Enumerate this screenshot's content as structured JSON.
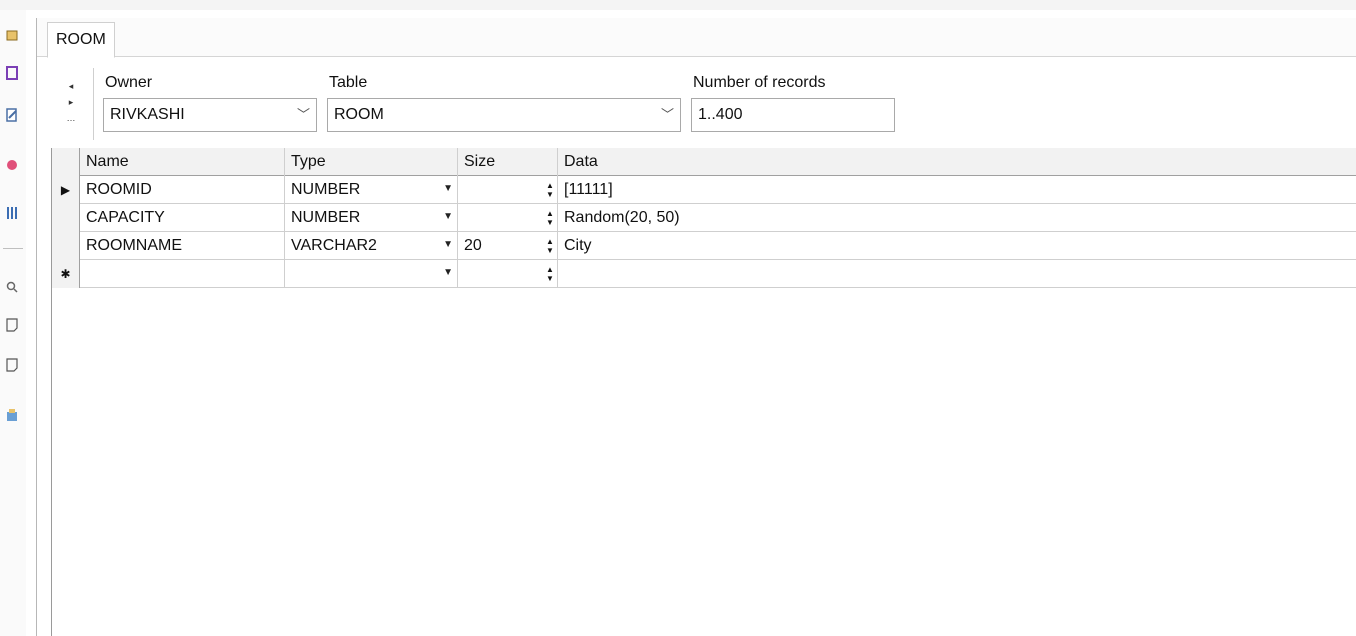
{
  "tab": {
    "label": "ROOM"
  },
  "nav": {
    "prev": "◂",
    "next": "▸",
    "more": "…"
  },
  "owner": {
    "label": "Owner",
    "value": "RIVKASHI"
  },
  "table": {
    "label": "Table",
    "value": "ROOM"
  },
  "records": {
    "label": "Number of records",
    "value": "1..400"
  },
  "grid": {
    "headers": {
      "name": "Name",
      "type": "Type",
      "size": "Size",
      "data": "Data"
    },
    "rows": [
      {
        "indicator": "▶",
        "name": "ROOMID",
        "type": "NUMBER",
        "size": "",
        "data": "[11111]"
      },
      {
        "indicator": "",
        "name": "CAPACITY",
        "type": "NUMBER",
        "size": "",
        "data": "Random(20, 50)"
      },
      {
        "indicator": "",
        "name": "ROOMNAME",
        "type": "VARCHAR2",
        "size": "20",
        "data": "City"
      },
      {
        "indicator": "✱",
        "name": "",
        "type": "",
        "size": "",
        "data": ""
      }
    ]
  },
  "colors": {
    "accent": "#c03080",
    "grid_header": "#f2f2f2"
  }
}
